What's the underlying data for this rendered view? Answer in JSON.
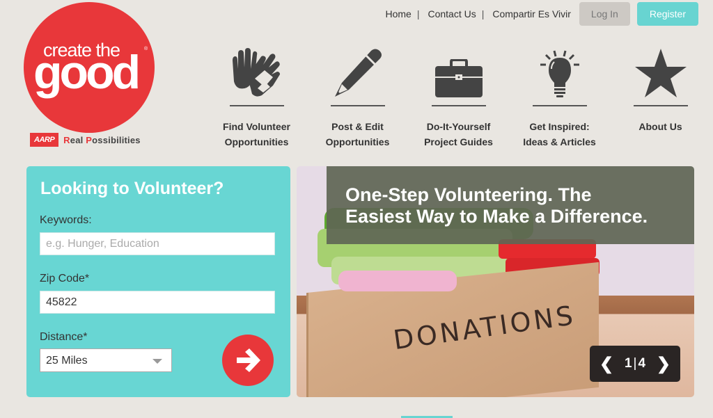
{
  "topnav": {
    "links": [
      "Home",
      "Contact Us",
      "Compartir Es Vivir"
    ],
    "separator": "|",
    "login_label": "Log In",
    "register_label": "Register"
  },
  "logo": {
    "line1": "create the",
    "line2": "good",
    "registered": "®",
    "aarp_badge": "AARP",
    "tagline_r": "R",
    "tagline_mid": "eal ",
    "tagline_p": "P",
    "tagline_end": "ossibilities"
  },
  "features": [
    {
      "icon": "gloves-icon",
      "label_line1": "Find Volunteer",
      "label_line2": "Opportunities"
    },
    {
      "icon": "pencil-icon",
      "label_line1": "Post & Edit",
      "label_line2": "Opportunities"
    },
    {
      "icon": "briefcase-icon",
      "label_line1": "Do-It-Yourself",
      "label_line2": "Project Guides"
    },
    {
      "icon": "lightbulb-icon",
      "label_line1": "Get Inspired:",
      "label_line2": "Ideas & Articles"
    },
    {
      "icon": "star-icon",
      "label_line1": "About Us",
      "label_line2": ""
    }
  ],
  "search": {
    "title": "Looking to Volunteer?",
    "keywords_label": "Keywords:",
    "keywords_placeholder": "e.g. Hunger, Education",
    "keywords_value": "",
    "zip_label": "Zip Code*",
    "zip_value": "45822",
    "distance_label": "Distance*",
    "distance_value": "25 Miles",
    "submit_icon": "arrow-right-icon"
  },
  "hero": {
    "headline_line1": "One-Step Volunteering. The",
    "headline_line2": "Easiest Way to Make a Difference.",
    "image_text": "DONATIONS",
    "pager": {
      "current": "1",
      "separator": "|",
      "total": "4",
      "prev": "❮",
      "next": "❯"
    }
  },
  "colors": {
    "brand_red": "#e8373a",
    "accent_teal": "#68d4d1",
    "background": "#e9e6e1"
  }
}
